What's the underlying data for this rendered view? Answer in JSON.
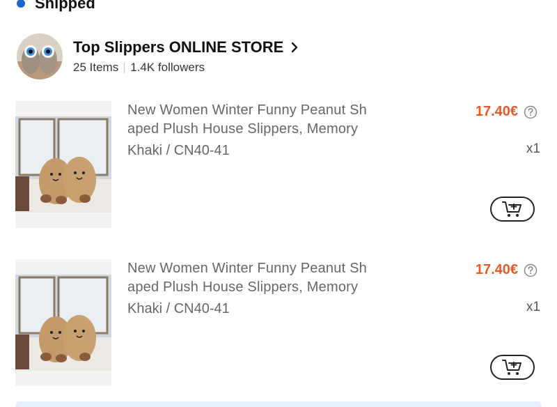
{
  "order": {
    "status": "Shipped",
    "status_color": "#1e63d6"
  },
  "store": {
    "name": "Top Slippers ONLINE STORE",
    "items_count": "25 Items",
    "followers": "1.4K followers",
    "avatar_icon": "slippers-avatar-icon"
  },
  "items": [
    {
      "title": "New Women Winter Funny Peanut Shaped Plush House Slippers, Memory",
      "title_line1": "New Women Winter Funny Peanut Sh",
      "title_line2": "aped Plush House Slippers, Memory",
      "variant": "Khaki / CN40-41",
      "price": "17.40€",
      "quantity": "x1"
    },
    {
      "title": "New Women Winter Funny Peanut Shaped Plush House Slippers, Memory",
      "title_line1": "New Women Winter Funny Peanut Sh",
      "title_line2": "aped Plush House Slippers, Memory",
      "variant": "Khaki / CN40-41",
      "price": "17.40€",
      "quantity": "x1"
    }
  ],
  "colors": {
    "price": "#e8592a",
    "accent": "#1e63d6"
  }
}
